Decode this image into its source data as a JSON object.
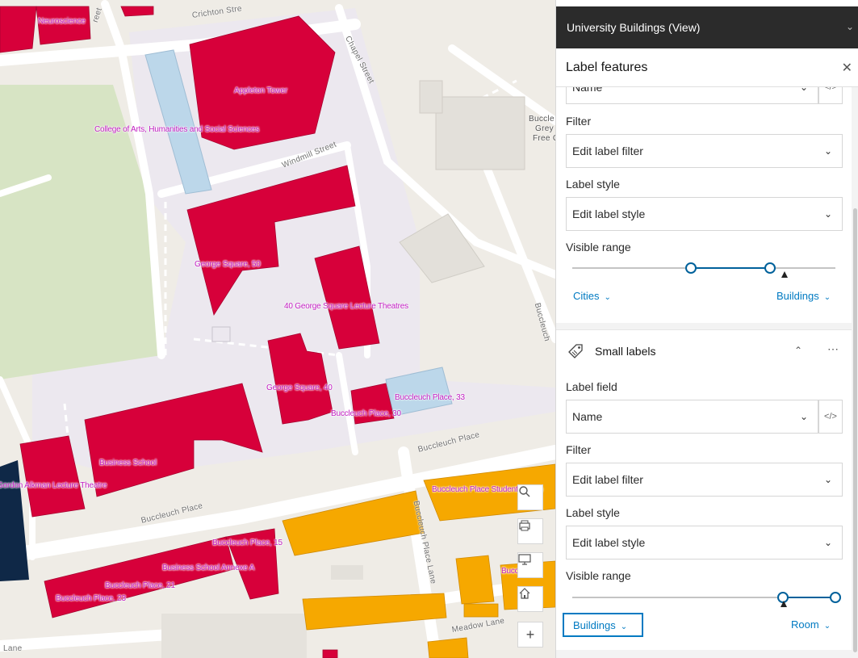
{
  "map": {
    "streets": {
      "crichton": "Crichton Stre",
      "chapel": "Chapel Street",
      "windmill": "Windmill Street",
      "buccleuch_place_1": "Buccleuch Place",
      "buccleuch_place_2": "Buccleuch Place",
      "buccleuch_place_lane": "Buccleuch Place Lane",
      "meadow_lane": "Meadow Lane",
      "lane": "Lane",
      "street_tl": "reet",
      "buccleuch_right": "Buccleuch"
    },
    "labels": {
      "neuroscience": "Neuroscience",
      "appleton": "Appleton Tower",
      "cahss": "College of Arts, Humanities and Social Sciences",
      "george50": "George Square, 50",
      "lecture40": "40 George Square Lecture Theatres",
      "george40": "George Square, 40",
      "bp33": "Buccleuch Place, 33",
      "bp30": "Buccleuch Place, 30",
      "business_school": "Business School",
      "gordon": "Gordon Aikman Lecture Theatre",
      "bp_student": "Buccleuch Place Student Comm",
      "bp15": "Buccleuch Place, 15",
      "bs_annexe": "Business School Annexe A",
      "bp21": "Buccleuch Place, 21",
      "bp23": "Buccleuch Place, 23",
      "bucc_right": "Bucc",
      "grey_line1": "Buccle",
      "grey_line2": "Grey",
      "grey_line3": "Free C"
    },
    "colors": {
      "building_red": "#d7003a",
      "building_orange": "#f6a800",
      "building_blue": "#bcd7ea",
      "park_green": "#d7e4c4",
      "campus": "#ece8ef",
      "navy": "#0f2847"
    }
  },
  "panel": {
    "layer_title": "University Buildings (View)",
    "section_title": "Label features",
    "top_class": {
      "label_field_value": "Name",
      "filter_label": "Filter",
      "filter_value": "Edit label filter",
      "style_label": "Label style",
      "style_value": "Edit label style",
      "range_label": "Visible range",
      "range_min": "Cities",
      "range_max": "Buildings",
      "range_start": 0.45,
      "range_end": 0.75
    },
    "small_labels": {
      "title": "Small labels",
      "label_field_label": "Label field",
      "label_field_value": "Name",
      "filter_label": "Filter",
      "filter_value": "Edit label filter",
      "style_label": "Label style",
      "style_value": "Edit label style",
      "range_label": "Visible range",
      "range_min": "Buildings",
      "range_max": "Room",
      "range_start": 0.8,
      "range_end": 1.0
    }
  }
}
